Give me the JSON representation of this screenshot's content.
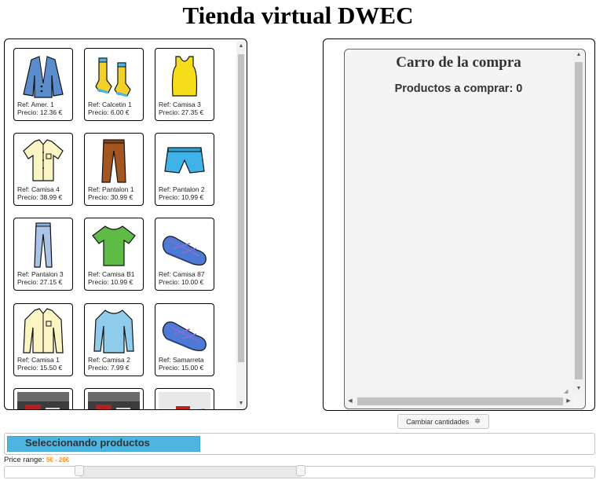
{
  "page": {
    "title": "Tienda virtual DWEC"
  },
  "catalog": {
    "products": [
      {
        "ref": "Ref: Amer. 1",
        "price": "Precio: 12.36 €",
        "icon": "blazer-icon"
      },
      {
        "ref": "Ref: Calcetin 1",
        "price": "Precio: 6.00 €",
        "icon": "socks-icon"
      },
      {
        "ref": "Ref: Camisa 3",
        "price": "Precio: 27.35 €",
        "icon": "tank-top-icon"
      },
      {
        "ref": "Ref: Camisa 4",
        "price": "Precio: 38.99 €",
        "icon": "short-sleeve-shirt-icon"
      },
      {
        "ref": "Ref: Pantalon 1",
        "price": "Precio: 30.99 €",
        "icon": "trousers-icon"
      },
      {
        "ref": "Ref: Pantalon 2",
        "price": "Precio: 10.99 €",
        "icon": "shorts-icon"
      },
      {
        "ref": "Ref: Pantalon 3",
        "price": "Precio: 27.15 €",
        "icon": "jeans-icon"
      },
      {
        "ref": "Ref: Camisa B1",
        "price": "Precio: 10.99 €",
        "icon": "tshirt-icon"
      },
      {
        "ref": "Ref: Camisa 87",
        "price": "Precio: 10.00 €",
        "icon": "slipper-icon"
      },
      {
        "ref": "Ref: Camisa 1",
        "price": "Precio: 15.50 €",
        "icon": "long-sleeve-shirt-icon"
      },
      {
        "ref": "Ref: Camisa 2",
        "price": "Precio: 7.99 €",
        "icon": "sweater-icon"
      },
      {
        "ref": "Ref: Samarreta",
        "price": "Precio: 15.00 €",
        "icon": "slipper-icon"
      },
      {
        "ref": "",
        "price": "",
        "icon": "racing-photo-icon"
      },
      {
        "ref": "",
        "price": "",
        "icon": "racing-photo-icon"
      },
      {
        "ref": "",
        "price": "",
        "icon": "race-car-photo-icon"
      }
    ]
  },
  "cart": {
    "title": "Carro de la compra",
    "count_label": "Productos a comprar: 0"
  },
  "controls": {
    "change_button": "Cambiar cantidades",
    "status_text": "Seleccionando productos",
    "status_progress": 0.33,
    "price_label": "Price range:",
    "price_value": "5€ - 20€",
    "price_min": 5,
    "price_max": 20
  },
  "colors": {
    "status_fill": "#4db5e0",
    "price_value": "#f6931f"
  }
}
